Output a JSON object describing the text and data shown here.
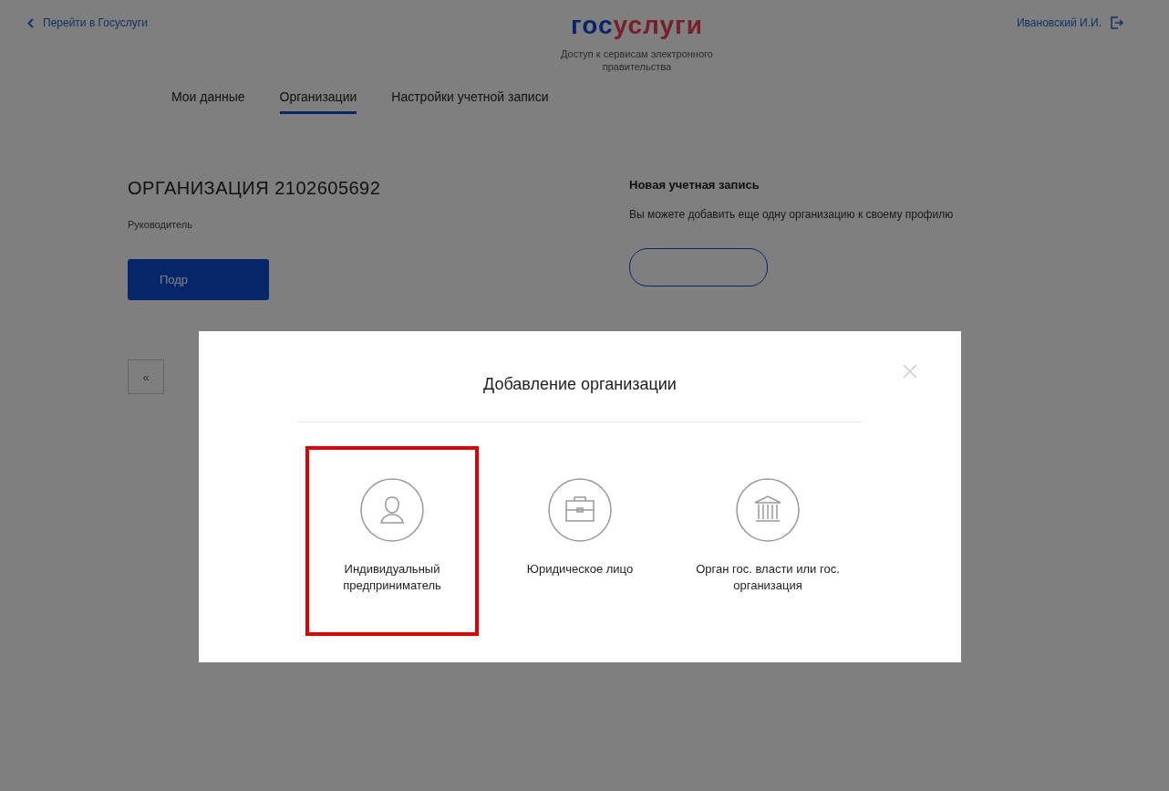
{
  "header": {
    "back_link": "Перейти в Госуслуги",
    "logo": {
      "part_1": "гос",
      "part_2": "услуги"
    },
    "subtitle": "Доступ к сервисам электронного правительства",
    "user_name": "Ивановский И.И."
  },
  "tabs": [
    {
      "label": "Мои данные",
      "selected": false
    },
    {
      "label": "Организации",
      "selected": true
    },
    {
      "label": "Настройки учетной записи",
      "selected": false
    }
  ],
  "organization": {
    "title": "ОРГАНИЗАЦИЯ 2102605692",
    "role": "Руководитель",
    "button": "Подр"
  },
  "new_account": {
    "title": "Новая учетная запись",
    "description": "Вы можете добавить еще одну организацию к своему профилю"
  },
  "pagination": {
    "label": "«"
  },
  "modal": {
    "title": "Добавление организации",
    "options": [
      {
        "kind": "person",
        "label": "Индивидуальный предприниматель",
        "highlighted": true
      },
      {
        "kind": "briefcase",
        "label": "Юридическое лицо",
        "highlighted": false
      },
      {
        "kind": "building",
        "label": "Орган гос. власти или гос. организация",
        "highlighted": false
      }
    ]
  }
}
